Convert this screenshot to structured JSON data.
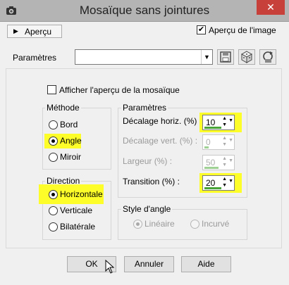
{
  "window": {
    "title": "Mosaïque sans jointures",
    "close_glyph": "✕"
  },
  "preview": {
    "toggle_label": "Aperçu",
    "image_preview_label": "Aperçu de l'image",
    "image_preview_checked": true
  },
  "presets": {
    "label": "Paramètres",
    "value": ""
  },
  "show_mosaic_preview": {
    "label": "Afficher l'aperçu de la mosaïque",
    "checked": false
  },
  "method": {
    "title": "Méthode",
    "options": [
      {
        "label": "Bord",
        "checked": false
      },
      {
        "label": "Angle",
        "checked": true
      },
      {
        "label": "Miroir",
        "checked": false
      }
    ]
  },
  "direction": {
    "title": "Direction",
    "options": [
      {
        "label": "Horizontale",
        "checked": true
      },
      {
        "label": "Verticale",
        "checked": false
      },
      {
        "label": "Bilatérale",
        "checked": false
      }
    ]
  },
  "parameters": {
    "title": "Paramètres",
    "fields": [
      {
        "label": "Décalage horiz. (%) :",
        "value": "10",
        "enabled": true
      },
      {
        "label": "Décalage vert. (%) :",
        "value": "0",
        "enabled": false
      },
      {
        "label": "Largeur (%) :",
        "value": "50",
        "enabled": false
      },
      {
        "label": "Transition (%) :",
        "value": "20",
        "enabled": true
      }
    ]
  },
  "angle_style": {
    "title": "Style d'angle",
    "options": [
      {
        "label": "Linéaire",
        "checked": true,
        "enabled": false
      },
      {
        "label": "Incurvé",
        "checked": false,
        "enabled": false
      }
    ]
  },
  "buttons": {
    "ok": "OK",
    "cancel": "Annuler",
    "help": "Aide"
  },
  "colors": {
    "highlight": "#fdfd2a",
    "close": "#c7413a",
    "slider": "#49a53a"
  }
}
